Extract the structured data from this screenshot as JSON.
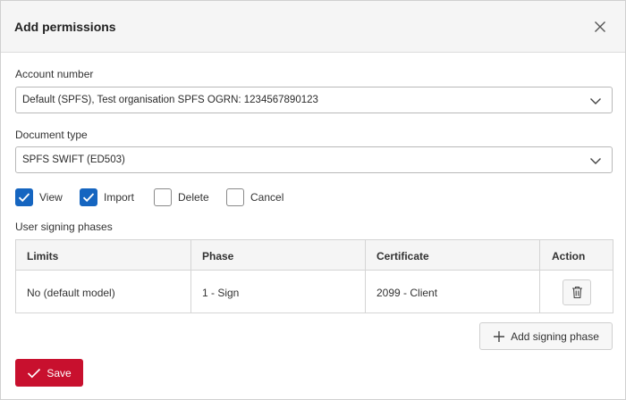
{
  "dialog": {
    "title": "Add permissions",
    "close_icon": "close-icon"
  },
  "account": {
    "label": "Account number",
    "value": "Default (SPFS), Test organisation SPFS OGRN: 1234567890123"
  },
  "document": {
    "label": "Document type",
    "value": "SPFS SWIFT (ED503)"
  },
  "permissions": [
    {
      "label": "View",
      "checked": true
    },
    {
      "label": "Import",
      "checked": true
    },
    {
      "label": "Delete",
      "checked": false
    },
    {
      "label": "Cancel",
      "checked": false
    }
  ],
  "phases": {
    "label": "User signing phases",
    "columns": [
      "Limits",
      "Phase",
      "Certificate",
      "Action"
    ],
    "rows": [
      {
        "limits": "No (default model)",
        "phase": "1 - Sign",
        "certificate": "2099 - Client",
        "action_icon": "trash-icon"
      }
    ],
    "add_label": "Add signing phase",
    "add_icon": "plus-icon"
  },
  "save": {
    "label": "Save",
    "icon": "checkmark-icon"
  },
  "colors": {
    "accent": "#1565c0",
    "save": "#c8102e"
  }
}
